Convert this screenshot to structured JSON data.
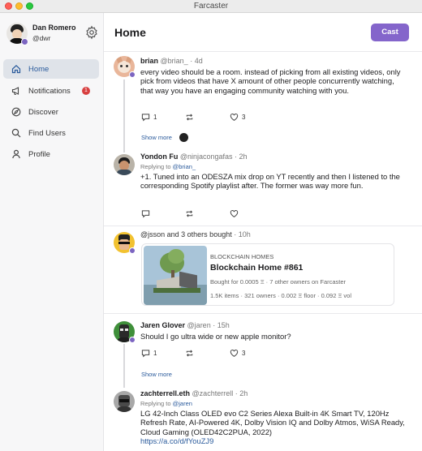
{
  "window": {
    "title": "Farcaster"
  },
  "user": {
    "name": "Dan Romero",
    "handle": "@dwr"
  },
  "nav": [
    {
      "label": "Home",
      "icon": "home-icon",
      "active": true
    },
    {
      "label": "Notifications",
      "icon": "megaphone-icon",
      "badge": "1"
    },
    {
      "label": "Discover",
      "icon": "compass-icon"
    },
    {
      "label": "Find Users",
      "icon": "search-icon"
    },
    {
      "label": "Profile",
      "icon": "user-icon"
    }
  ],
  "header": {
    "title": "Home",
    "cast_label": "Cast"
  },
  "colors": {
    "accent": "#8465cb",
    "link": "#2b5b9c",
    "badge": "#d84040"
  },
  "posts": [
    {
      "name": "brian",
      "handle": "@brian_",
      "time": "· 4d",
      "text": "every video should be a room. instead of picking from all existing videos, only pick from videos that have X amount of other people concurrently watching, that way you have an engaging community watching with you.",
      "replies": "1",
      "recasts": "",
      "likes": "3",
      "show_more": "Show more"
    },
    {
      "name": "Yondon Fu",
      "handle": "@ninjacongafas",
      "time": "· 2h",
      "replying_prefix": "Replying to",
      "replying_to": "@brian_",
      "text": "+1. Tuned into an ODESZA mix drop on YT recently and then I listened to the corresponding Spotify playlist after. The former was way more fun."
    },
    {
      "header_text": "@jsson and 3 others bought",
      "time": "· 10h",
      "nft": {
        "collection": "BLOCKCHAIN HOMES",
        "title": "Blockchain Home #861",
        "bought": "Bought for 0.0005 Ξ · 7 other owners on Farcaster",
        "stats": "1.5K items · 321 owners · 0.002 Ξ floor · 0.092 Ξ vol"
      }
    },
    {
      "name": "Jaren Glover",
      "handle": "@jaren",
      "time": "· 15h",
      "text": "Should I go ultra wide or new apple monitor?",
      "replies": "1",
      "likes": "3",
      "show_more": "Show more"
    },
    {
      "name": "zachterrell.eth",
      "handle": "@zachterrell",
      "time": "· 2h",
      "replying_prefix": "Replying to",
      "replying_to": "@jaren",
      "text": "LG 42-Inch Class OLED evo C2 Series Alexa Built-in 4K Smart TV, 120Hz Refresh Rate, AI-Powered 4K, Dolby Vision IQ and Dolby Atmos, WiSA Ready, Cloud Gaming (OLED42C2PUA, 2022)",
      "link": "https://a.co/d/fYouZJ9"
    }
  ]
}
